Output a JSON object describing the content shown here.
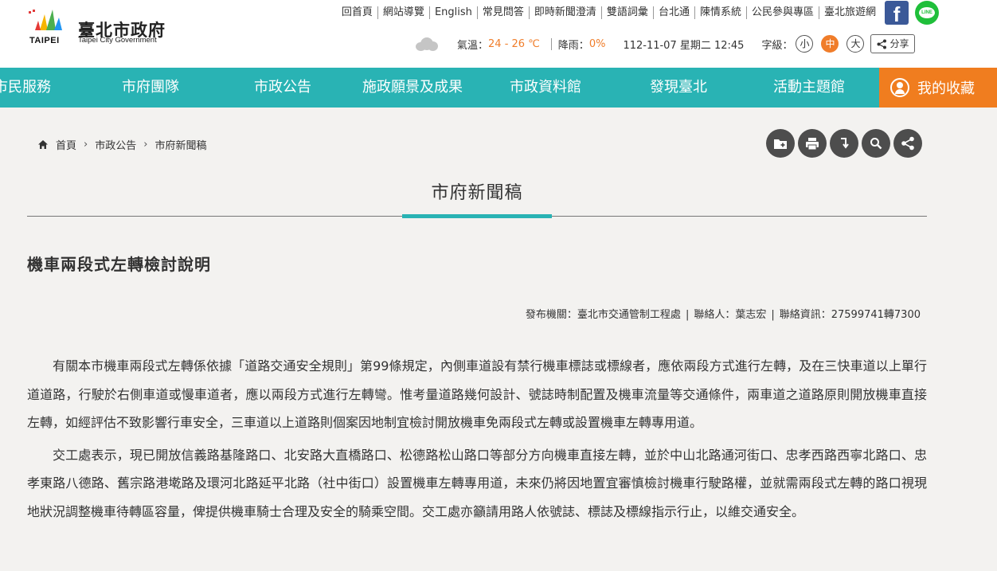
{
  "header": {
    "logo_cn": "臺北市政府",
    "logo_en": "Taipei City Government",
    "logo_taipei": "TAIPEI",
    "top_links": [
      "回首頁",
      "網站導覽",
      "English",
      "常見問答",
      "即時新聞澄清",
      "雙語詞彙",
      "台北通",
      "陳情系統",
      "公民參與專區",
      "臺北旅遊網"
    ],
    "facebook_label": "f",
    "line_label": "LINE",
    "weather": {
      "temp_label": "氣溫：",
      "temp_value": "24 - 26 ℃",
      "rain_label": "降雨：",
      "rain_value": "0%",
      "datetime": "112-11-07 星期二 12:45"
    },
    "font_size_label": "字級：",
    "font_sizes": [
      "小",
      "中",
      "大"
    ],
    "share_label": "分享"
  },
  "nav": {
    "items": [
      "市民服務",
      "市府團隊",
      "市政公告",
      "施政願景及成果",
      "市政資料館",
      "發現臺北",
      "活動主題館"
    ],
    "favorites": "我的收藏"
  },
  "breadcrumb": [
    "首頁",
    "市政公告",
    "市府新聞稿"
  ],
  "page_title": "市府新聞稿",
  "article": {
    "title": "機車兩段式左轉檢討說明",
    "meta": {
      "publisher": "發布機關：臺北市交通管制工程處",
      "contact": "聯絡人：葉志宏",
      "contact_info": "聯絡資訊：27599741轉7300"
    },
    "paragraphs": [
      "有關本市機車兩段式左轉係依據「道路交通安全規則」第99條規定，內側車道設有禁行機車標誌或標線者，應依兩段方式進行左轉，及在三快車道以上單行道道路，行駛於右側車道或慢車道者，應以兩段方式進行左轉彎。惟考量道路幾何設計、號誌時制配置及機車流量等交通條件，兩車道之道路原則開放機車直接左轉，如經評估不致影響行車安全，三車道以上道路則個案因地制宜檢討開放機車免兩段式左轉或設置機車左轉專用道。",
      "交工處表示，現已開放信義路基隆路口、北安路大直橋路口、松德路松山路口等部分方向機車直接左轉，並於中山北路通河街口、忠孝西路西寧北路口、忠孝東路八德路、舊宗路港墘路及環河北路延平北路（社中街口）設置機車左轉專用道，未來仍將因地置宜審慎檢討機車行駛路權，並就需兩段式左轉的路口視現地狀況調整機車待轉區容量，俾提供機車騎士合理及安全的騎乘空間。交工處亦籲請用路人依號誌、標誌及標線指示行止，以維交通安全。"
    ]
  },
  "colors": {
    "teal": "#29b3b4",
    "orange": "#f07d1f"
  }
}
